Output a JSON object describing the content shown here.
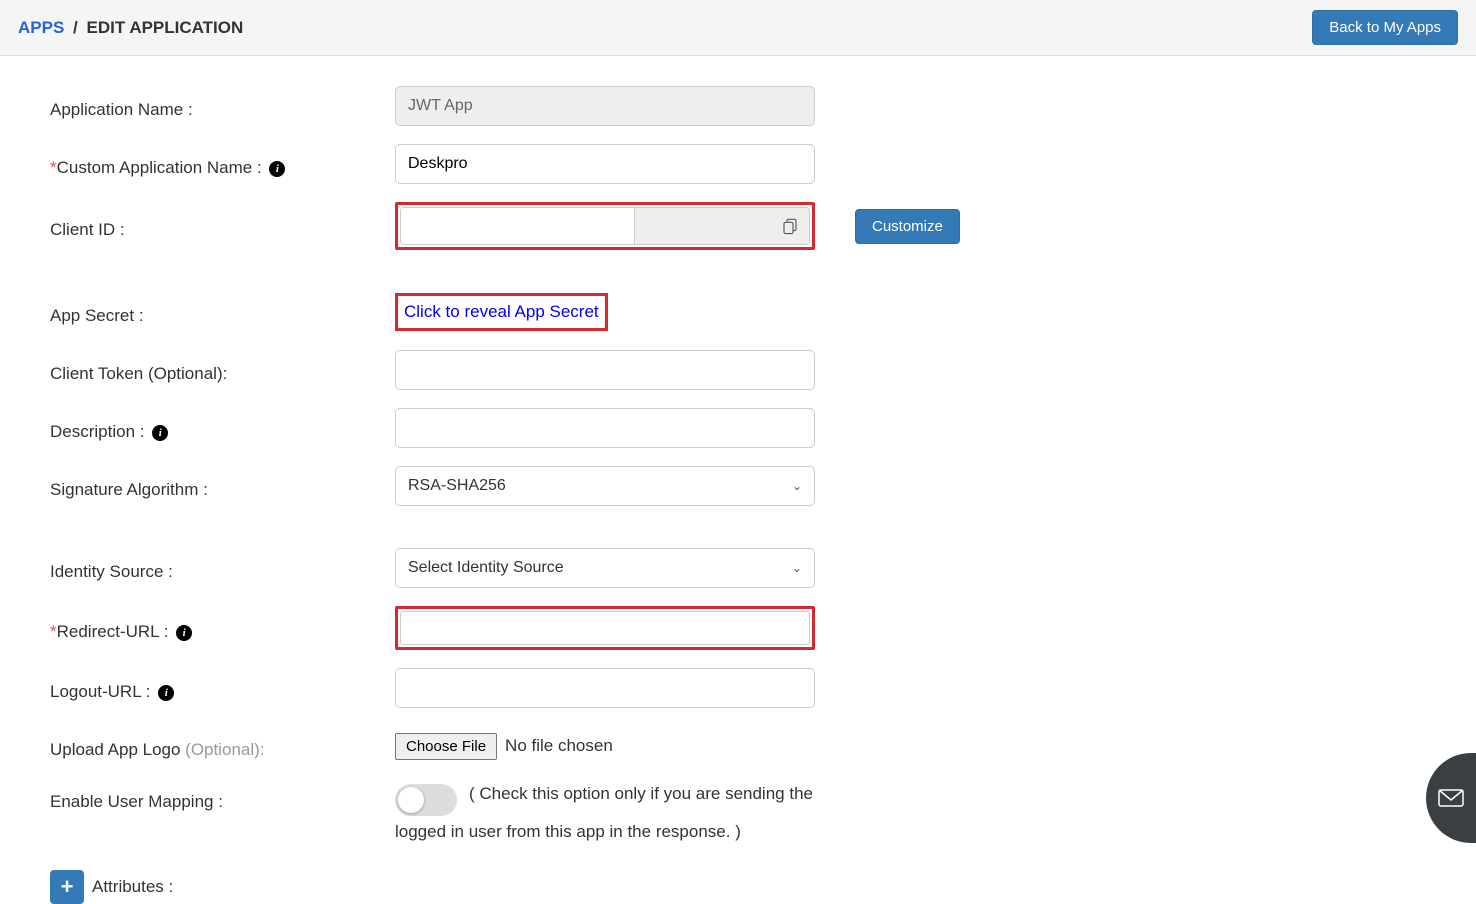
{
  "breadcrumb": {
    "link": "APPS",
    "current": "EDIT APPLICATION"
  },
  "header": {
    "back_button": "Back to My Apps"
  },
  "labels": {
    "app_name": "Application Name :",
    "custom_app_name": "Custom Application Name :",
    "client_id": "Client ID :",
    "app_secret": "App Secret :",
    "client_token": "Client Token (Optional):",
    "description": "Description :",
    "signature_algorithm": "Signature Algorithm :",
    "identity_source": "Identity Source :",
    "redirect_url": "Redirect-URL :",
    "logout_url": "Logout-URL :",
    "upload_logo": "Upload App Logo ",
    "upload_logo_optional": "(Optional):",
    "enable_user_mapping": "Enable User Mapping :",
    "attributes": "Attributes :"
  },
  "values": {
    "app_name": "JWT App",
    "custom_app_name": "Deskpro",
    "client_id": "",
    "client_token": "",
    "description": "",
    "signature_algorithm": "RSA-SHA256",
    "identity_source": "Select Identity Source",
    "redirect_url": "",
    "logout_url": ""
  },
  "actions": {
    "customize": "Customize",
    "reveal_secret": "Click to reveal App Secret",
    "choose_file": "Choose File",
    "file_status": "No file chosen"
  },
  "notes": {
    "mapping_line1": " ( Check this option only if you are sending the",
    "mapping_line2": "logged in user from this app in the response. )"
  }
}
